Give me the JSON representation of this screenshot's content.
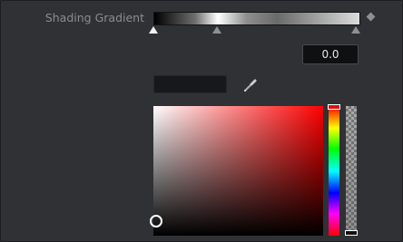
{
  "shading_gradient": {
    "label": "Shading Gradient",
    "stops": [
      "white-stop",
      "grey-stop",
      "grey-stop"
    ],
    "keyframe_icon": "diamond-icon"
  },
  "value_field": {
    "value": "0.0"
  },
  "color_picker": {
    "swatch_color": "#17181a",
    "eyedropper_icon": "eyedropper-icon",
    "hue_color": "#ff0000"
  },
  "colors": {
    "background": "#2f3134",
    "field_bg": "#0f1012",
    "label_text": "#8a8d91"
  }
}
